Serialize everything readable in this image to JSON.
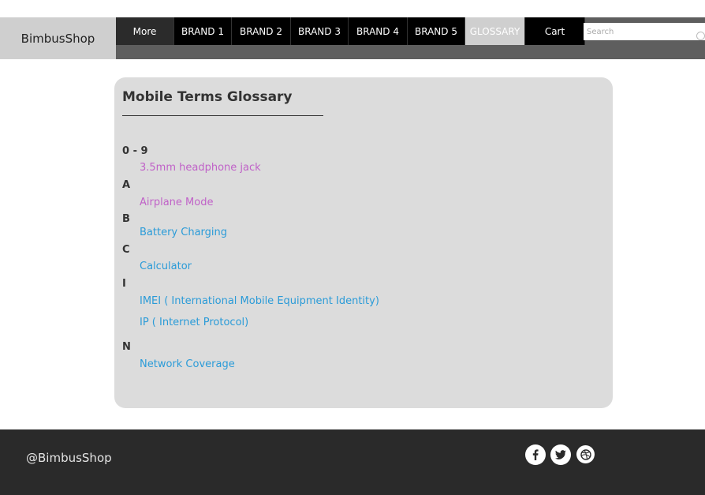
{
  "header": {
    "logo": "BimbusShop",
    "nav": {
      "more": "More",
      "brand1": "BRAND 1",
      "brand2": "BRAND 2",
      "brand3": "BRAND 3",
      "brand4": "BRAND 4",
      "brand5": "BRAND 5",
      "glossary": "GLOSSARY",
      "cart": "Cart"
    },
    "search": {
      "placeholder": "Search",
      "icon": "search-icon"
    }
  },
  "glossary": {
    "title": "Mobile Terms Glossary",
    "sections": {
      "s0": {
        "letter": "0 - 9",
        "terms": [
          "3.5mm headphone jack"
        ]
      },
      "sA": {
        "letter": "A",
        "terms": [
          "Airplane Mode"
        ]
      },
      "sB": {
        "letter": "B",
        "terms": [
          "Battery Charging"
        ]
      },
      "sC": {
        "letter": "C",
        "terms": [
          "Calculator"
        ]
      },
      "sI": {
        "letter": "I",
        "terms": [
          "IMEI ( International Mobile Equipment Identity)",
          "IP ( Internet Protocol)"
        ]
      },
      "sN": {
        "letter": "N",
        "terms": [
          "Network Coverage"
        ]
      }
    }
  },
  "colors": {
    "visited_link": "#c062c8",
    "link": "#2a9bd8",
    "footer_bg": "#2a2a2a",
    "panel_bg": "#dcdcdc"
  },
  "footer": {
    "handle": "@BimbusShop",
    "social_icons": [
      "facebook-icon",
      "twitter-icon",
      "dribbble-icon"
    ]
  }
}
